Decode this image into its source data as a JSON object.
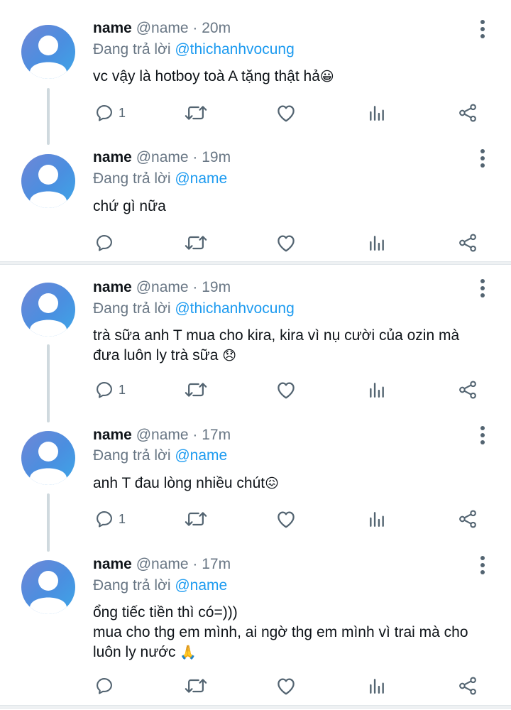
{
  "tweets": [
    {
      "name": "name",
      "handle": "@name",
      "time": "· 20m",
      "replying_prefix": "Đang trả lời",
      "replying_to": "@thichanhvocung",
      "text": "vc vậy là hotboy toà A tặng thật hả",
      "emoji": "😀",
      "reply_count": "1"
    },
    {
      "name": "name",
      "handle": "@name",
      "time": "· 19m",
      "replying_prefix": "Đang trả lời",
      "replying_to": "@name",
      "text": "chứ gì nữa",
      "emoji": "",
      "reply_count": ""
    },
    {
      "name": "name",
      "handle": "@name",
      "time": "· 19m",
      "replying_prefix": "Đang trả lời",
      "replying_to": "@thichanhvocung",
      "text": "trà sữa anh T mua cho kira, kira vì nụ cười của ozin mà\nđưa luôn ly trà sữa ",
      "emoji": "😞",
      "reply_count": "1"
    },
    {
      "name": "name",
      "handle": "@name",
      "time": "· 17m",
      "replying_prefix": "Đang trả lời",
      "replying_to": "@name",
      "text": "anh T đau lòng nhiều chút",
      "emoji": "😖",
      "reply_count": "1"
    },
    {
      "name": "name",
      "handle": "@name",
      "time": "· 17m",
      "replying_prefix": "Đang trả lời",
      "replying_to": "@name",
      "text": "ổng tiếc tiền thì có=)))\nmua cho thg em mình, ai ngờ thg em mình vì trai mà cho\nluôn ly nước ",
      "emoji": "🙏",
      "reply_count": ""
    }
  ],
  "icons": {
    "reply": "reply-icon",
    "retweet": "retweet-icon",
    "like": "heart-icon",
    "views": "views-chart-icon",
    "share": "share-icon",
    "more": "more-vertical-icon",
    "avatar": "default-avatar"
  },
  "colors": {
    "mention": "#1d9bf0",
    "muted": "#687684",
    "icon": "#536471",
    "avatar_gradient_start": "#6f86d6",
    "avatar_gradient_end": "#3ea7e8"
  }
}
